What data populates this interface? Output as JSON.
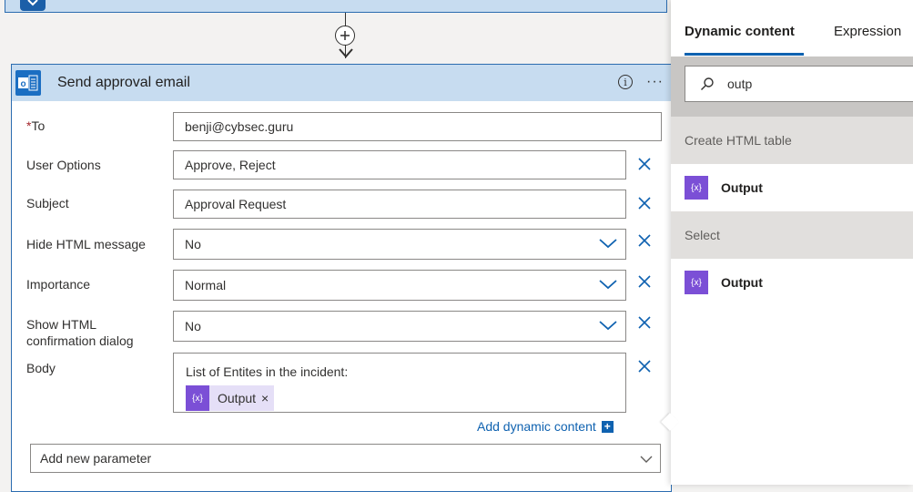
{
  "card": {
    "title": "Send approval email",
    "more": "···"
  },
  "fields": {
    "to": {
      "required_mark": "*",
      "label": "To",
      "value": "benji@cybsec.guru"
    },
    "user_options": {
      "label": "User Options",
      "value": "Approve, Reject"
    },
    "subject": {
      "label": "Subject",
      "value": "Approval Request"
    },
    "hide_html": {
      "label": "Hide HTML message",
      "value": "No"
    },
    "importance": {
      "label": "Importance",
      "value": "Normal"
    },
    "show_html": {
      "label_line1": "Show HTML",
      "label_line2": "confirmation dialog",
      "value": "No"
    },
    "body": {
      "label": "Body",
      "text": "List of Entites in the incident:",
      "token_label": "Output",
      "token_close": "×"
    }
  },
  "add_dynamic": "Add dynamic content",
  "add_parameter": "Add new parameter",
  "panel": {
    "tabs": [
      "Dynamic content",
      "Expression"
    ],
    "search_value": "outp",
    "groups": [
      {
        "section": "Create HTML table",
        "item": "Output"
      },
      {
        "section": "Select",
        "item": "Output"
      }
    ]
  },
  "colors": {
    "accent": "#0f62b0",
    "header": "#c7dcf0",
    "token": "#7b4fd6"
  }
}
